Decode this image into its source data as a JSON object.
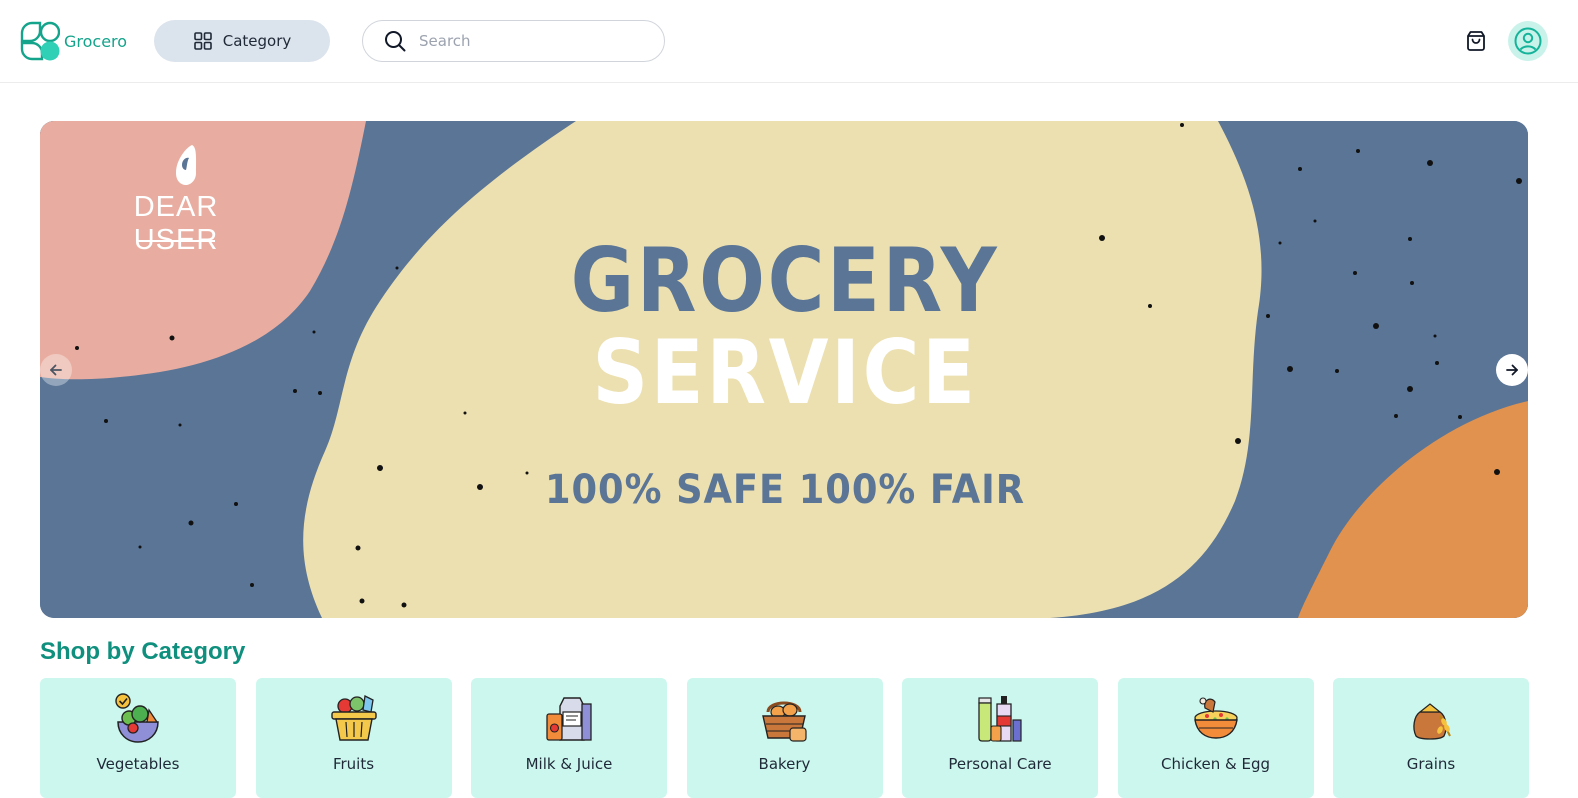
{
  "header": {
    "brand": "Grocero",
    "category_label": "Category",
    "search_placeholder": "Search"
  },
  "banner": {
    "greeting": "DEAR USER",
    "title_line1": "GROCERY",
    "title_line2": "SERVICE",
    "subtitle": "100% SAFE 100% FAIR"
  },
  "categories": {
    "title": "Shop by Category",
    "items": [
      {
        "label": "Vegetables",
        "icon": "vegetables-icon"
      },
      {
        "label": "Fruits",
        "icon": "fruits-basket-icon"
      },
      {
        "label": "Milk & Juice",
        "icon": "milk-juice-icon"
      },
      {
        "label": "Bakery",
        "icon": "bakery-basket-icon"
      },
      {
        "label": "Personal Care",
        "icon": "personal-care-icon"
      },
      {
        "label": "Chicken & Egg",
        "icon": "chicken-egg-icon"
      },
      {
        "label": "Grains",
        "icon": "grains-sack-icon"
      }
    ]
  },
  "colors": {
    "brand": "#14a38b",
    "category_button_bg": "#dbe3ec",
    "card_bg": "#ccf7ee",
    "banner_blue": "#5a7596",
    "banner_cream": "#ece0b0",
    "banner_pink": "#e8ada0",
    "banner_orange": "#e0924e"
  }
}
